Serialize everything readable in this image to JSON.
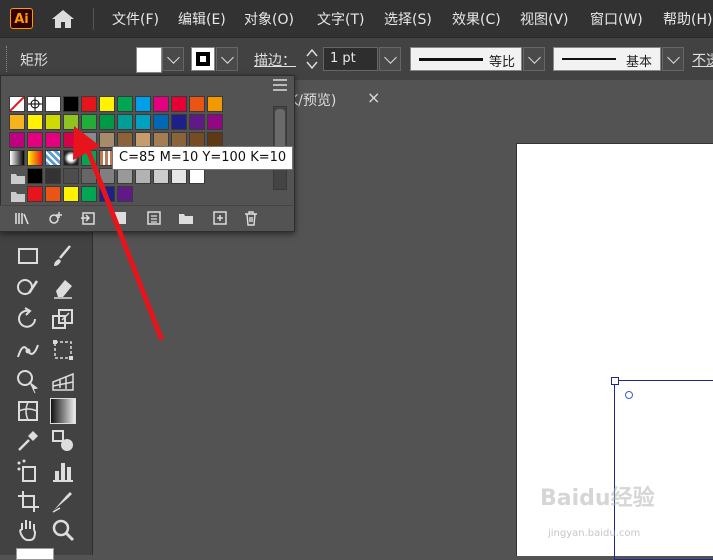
{
  "app": {
    "logo_text": "Ai",
    "home_icon": "home-icon"
  },
  "menu": [
    "文件(F)",
    "编辑(E)",
    "对象(O)",
    "文字(T)",
    "选择(S)",
    "效果(C)",
    "视图(V)",
    "窗口(W)",
    "帮助(H)"
  ],
  "control_bar": {
    "selection_label": "矩形",
    "stroke_label": "描边：",
    "stroke_weight": "1 pt",
    "profile_uniform": "等比",
    "brush_basic": "基本",
    "opacity_cut": "不透"
  },
  "document_tab": {
    "title": "K/预览)",
    "close": "×"
  },
  "swatches": {
    "tooltip": "C=85 M=10 Y=100 K=10",
    "row1": [
      "#ffffff",
      "#000000",
      "#e8141c",
      "#fff200",
      "#00a651",
      "#00a0e9",
      "#e4007f",
      "#e60033",
      "#ea5514",
      "#f39800"
    ],
    "row2": [
      "#f6b31b",
      "#fff100",
      "#cfdb00",
      "#8fc31f",
      "#22ac38",
      "#009944",
      "#009e96",
      "#00a0c1",
      "#0068b7",
      "#1d2088",
      "#601986",
      "#920783"
    ],
    "row3": [
      "#be0081",
      "#e5007f",
      "#e4007f",
      "#d7004b",
      "#898989",
      "#a68b6b",
      "#8c6239",
      "#c69c6d",
      "#a67c52",
      "#8c6239",
      "#754c24",
      "#603813"
    ],
    "row4_grays": [
      "#333333",
      "#4d4d4d",
      "#666666",
      "#808080",
      "#999999",
      "#b3b3b3",
      "#cccccc",
      "#e6e6e6",
      "#f2f2f2"
    ],
    "row5_group1": [
      "#000000",
      "#333333",
      "#4d4d4d",
      "#666666",
      "#808080",
      "#999999",
      "#b3b3b3",
      "#cccccc",
      "#e6e6e6",
      "#ffffff"
    ],
    "row6_group2": [
      "#e8141c",
      "#ea5514",
      "#fff200",
      "#00a651",
      "#1d2088",
      "#601986"
    ]
  },
  "watermark": {
    "brand": "Baidu经验",
    "url": "jingyan.baidu.com"
  }
}
